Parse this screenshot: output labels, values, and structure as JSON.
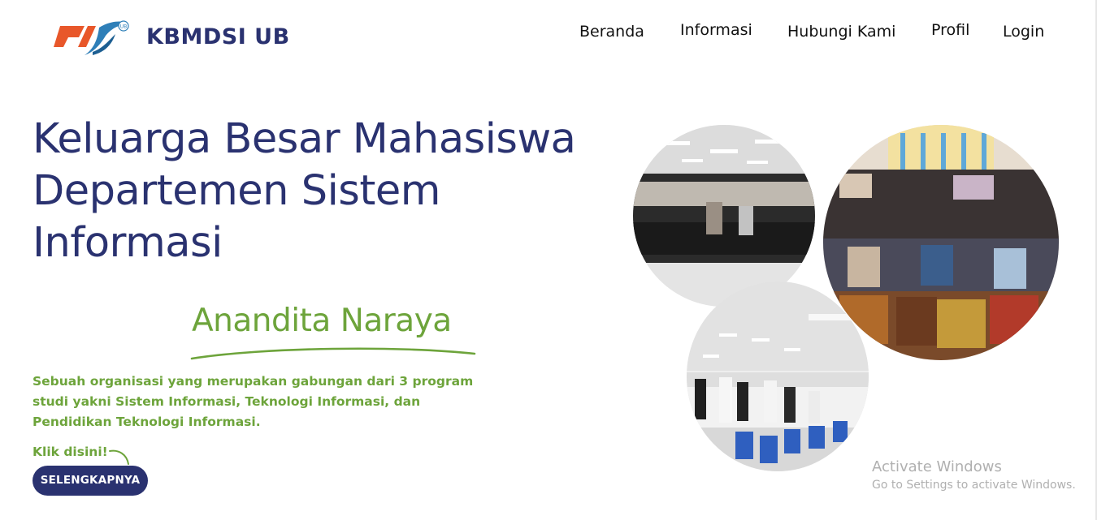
{
  "header": {
    "brand": "KBMDSI UB",
    "logo_mark_text": "UB",
    "nav": [
      "Beranda",
      "Informasi",
      "Hubungi Kami",
      "Profil",
      "Login"
    ]
  },
  "hero": {
    "title_lines": [
      "Keluarga Besar Mahasiswa",
      "Departemen Sistem",
      "Informasi"
    ],
    "name": "Anandita Naraya",
    "description": "Sebuah organisasi yang merupakan gabungan dari 3 program studi yakni Sistem Informasi, Teknologi Informasi, dan Pendidikan Teknologi Informasi.",
    "click_label": "Klik disini!",
    "cta_label": "SELENGKAPNYA"
  },
  "watermark": {
    "title": "Activate Windows",
    "subtitle": "Go to Settings to activate Windows."
  },
  "colors": {
    "primary": "#2a3270",
    "accent_green": "#6da43b",
    "logo_orange": "#e8572a",
    "logo_blue": "#2e7fb8"
  }
}
